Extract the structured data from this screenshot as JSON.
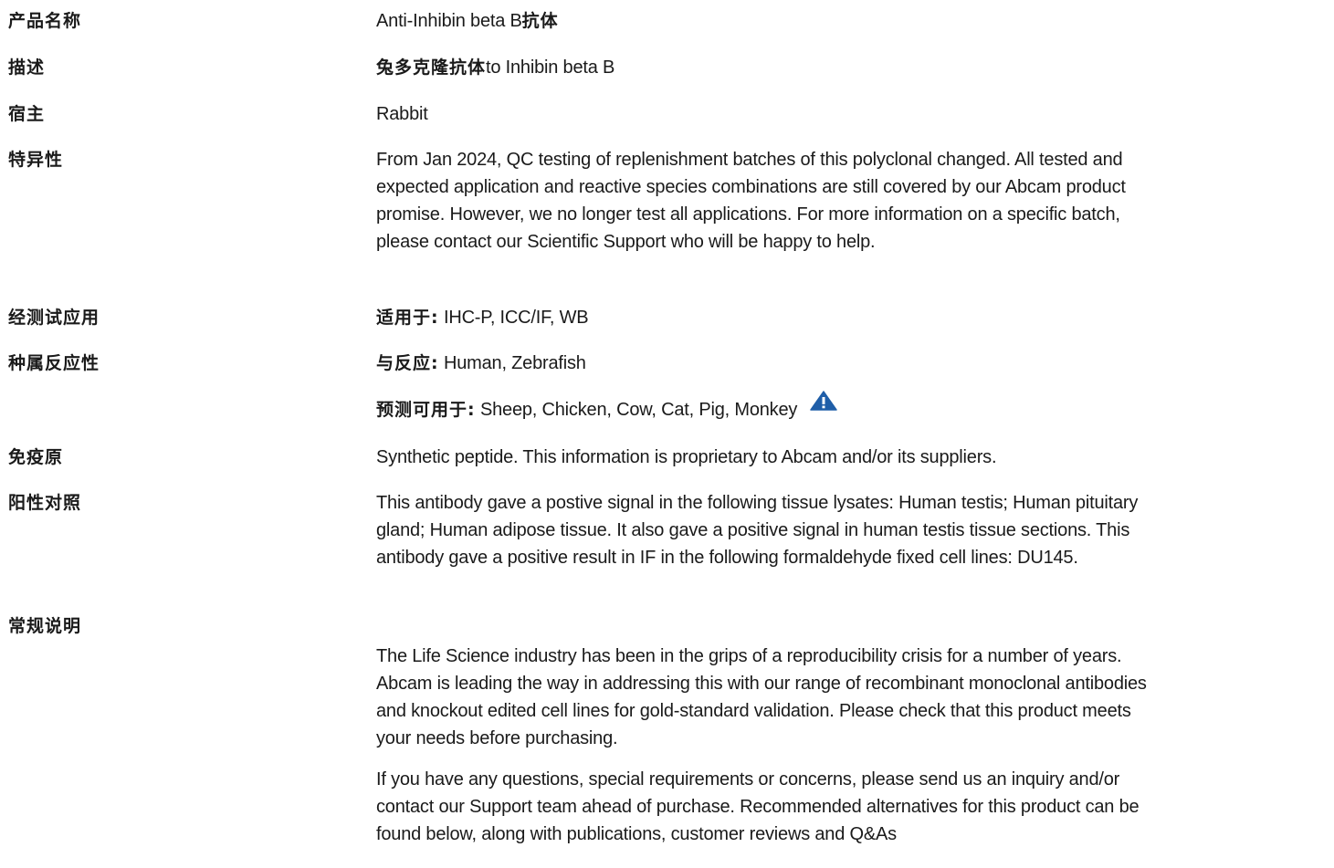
{
  "rows": {
    "product_name": {
      "label": "产品名称",
      "value": "Anti-Inhibin beta B",
      "value_suffix": "抗体"
    },
    "description": {
      "label": "描述",
      "value_prefix": "兔多克隆抗体",
      "value": "to Inhibin beta B"
    },
    "host": {
      "label": "宿主",
      "value": "Rabbit"
    },
    "specificity": {
      "label": "特异性",
      "lines": [
        "From Jan 2024, QC testing of replenishment batches of this polyclonal changed. All tested and",
        "expected application and reactive species combinations are still covered by our Abcam product",
        "promise. However, we no longer test all applications. For more information on a specific batch,",
        "please contact our Scientific Support who will be happy to help."
      ]
    },
    "tested_applications": {
      "label": "经测试应用",
      "prefix": "适用于:",
      "value": "IHC-P, ICC/IF, WB"
    },
    "species_reactivity": {
      "label": "种属反应性",
      "reacts_prefix": "与反应:",
      "reacts_value": "Human, Zebrafish",
      "predicted_prefix": "预测可用于:",
      "predicted_value": "Sheep, Chicken, Cow, Cat, Pig, Monkey",
      "icon": "warning-triangle-icon",
      "icon_color": "#1f5ea8"
    },
    "immunogen": {
      "label": "免疫原",
      "value": "Synthetic peptide. This information is proprietary to Abcam and/or its suppliers."
    },
    "positive_control": {
      "label": "阳性对照",
      "lines": [
        "This antibody gave a postive signal in the following tissue lysates: Human testis; Human pituitary",
        "gland; Human adipose tissue. It also gave a positive signal in human testis tissue sections. This",
        "antibody gave a positive result in IF in the following formaldehyde fixed cell lines: DU145."
      ]
    },
    "general_notes": {
      "label": "常规说明",
      "paragraph1": [
        "The Life Science industry has been in the grips of a reproducibility crisis for a number of years.",
        "Abcam is leading the way in addressing this with our range of recombinant monoclonal antibodies",
        "and knockout edited cell lines for gold-standard validation. Please check that this product meets",
        "your needs before purchasing."
      ],
      "paragraph2": [
        "If you have any questions, special requirements or concerns, please send us an inquiry and/or",
        "contact our Support team ahead of purchase. Recommended alternatives for this product can be",
        "found below, along with publications, customer reviews and Q&As"
      ]
    }
  }
}
